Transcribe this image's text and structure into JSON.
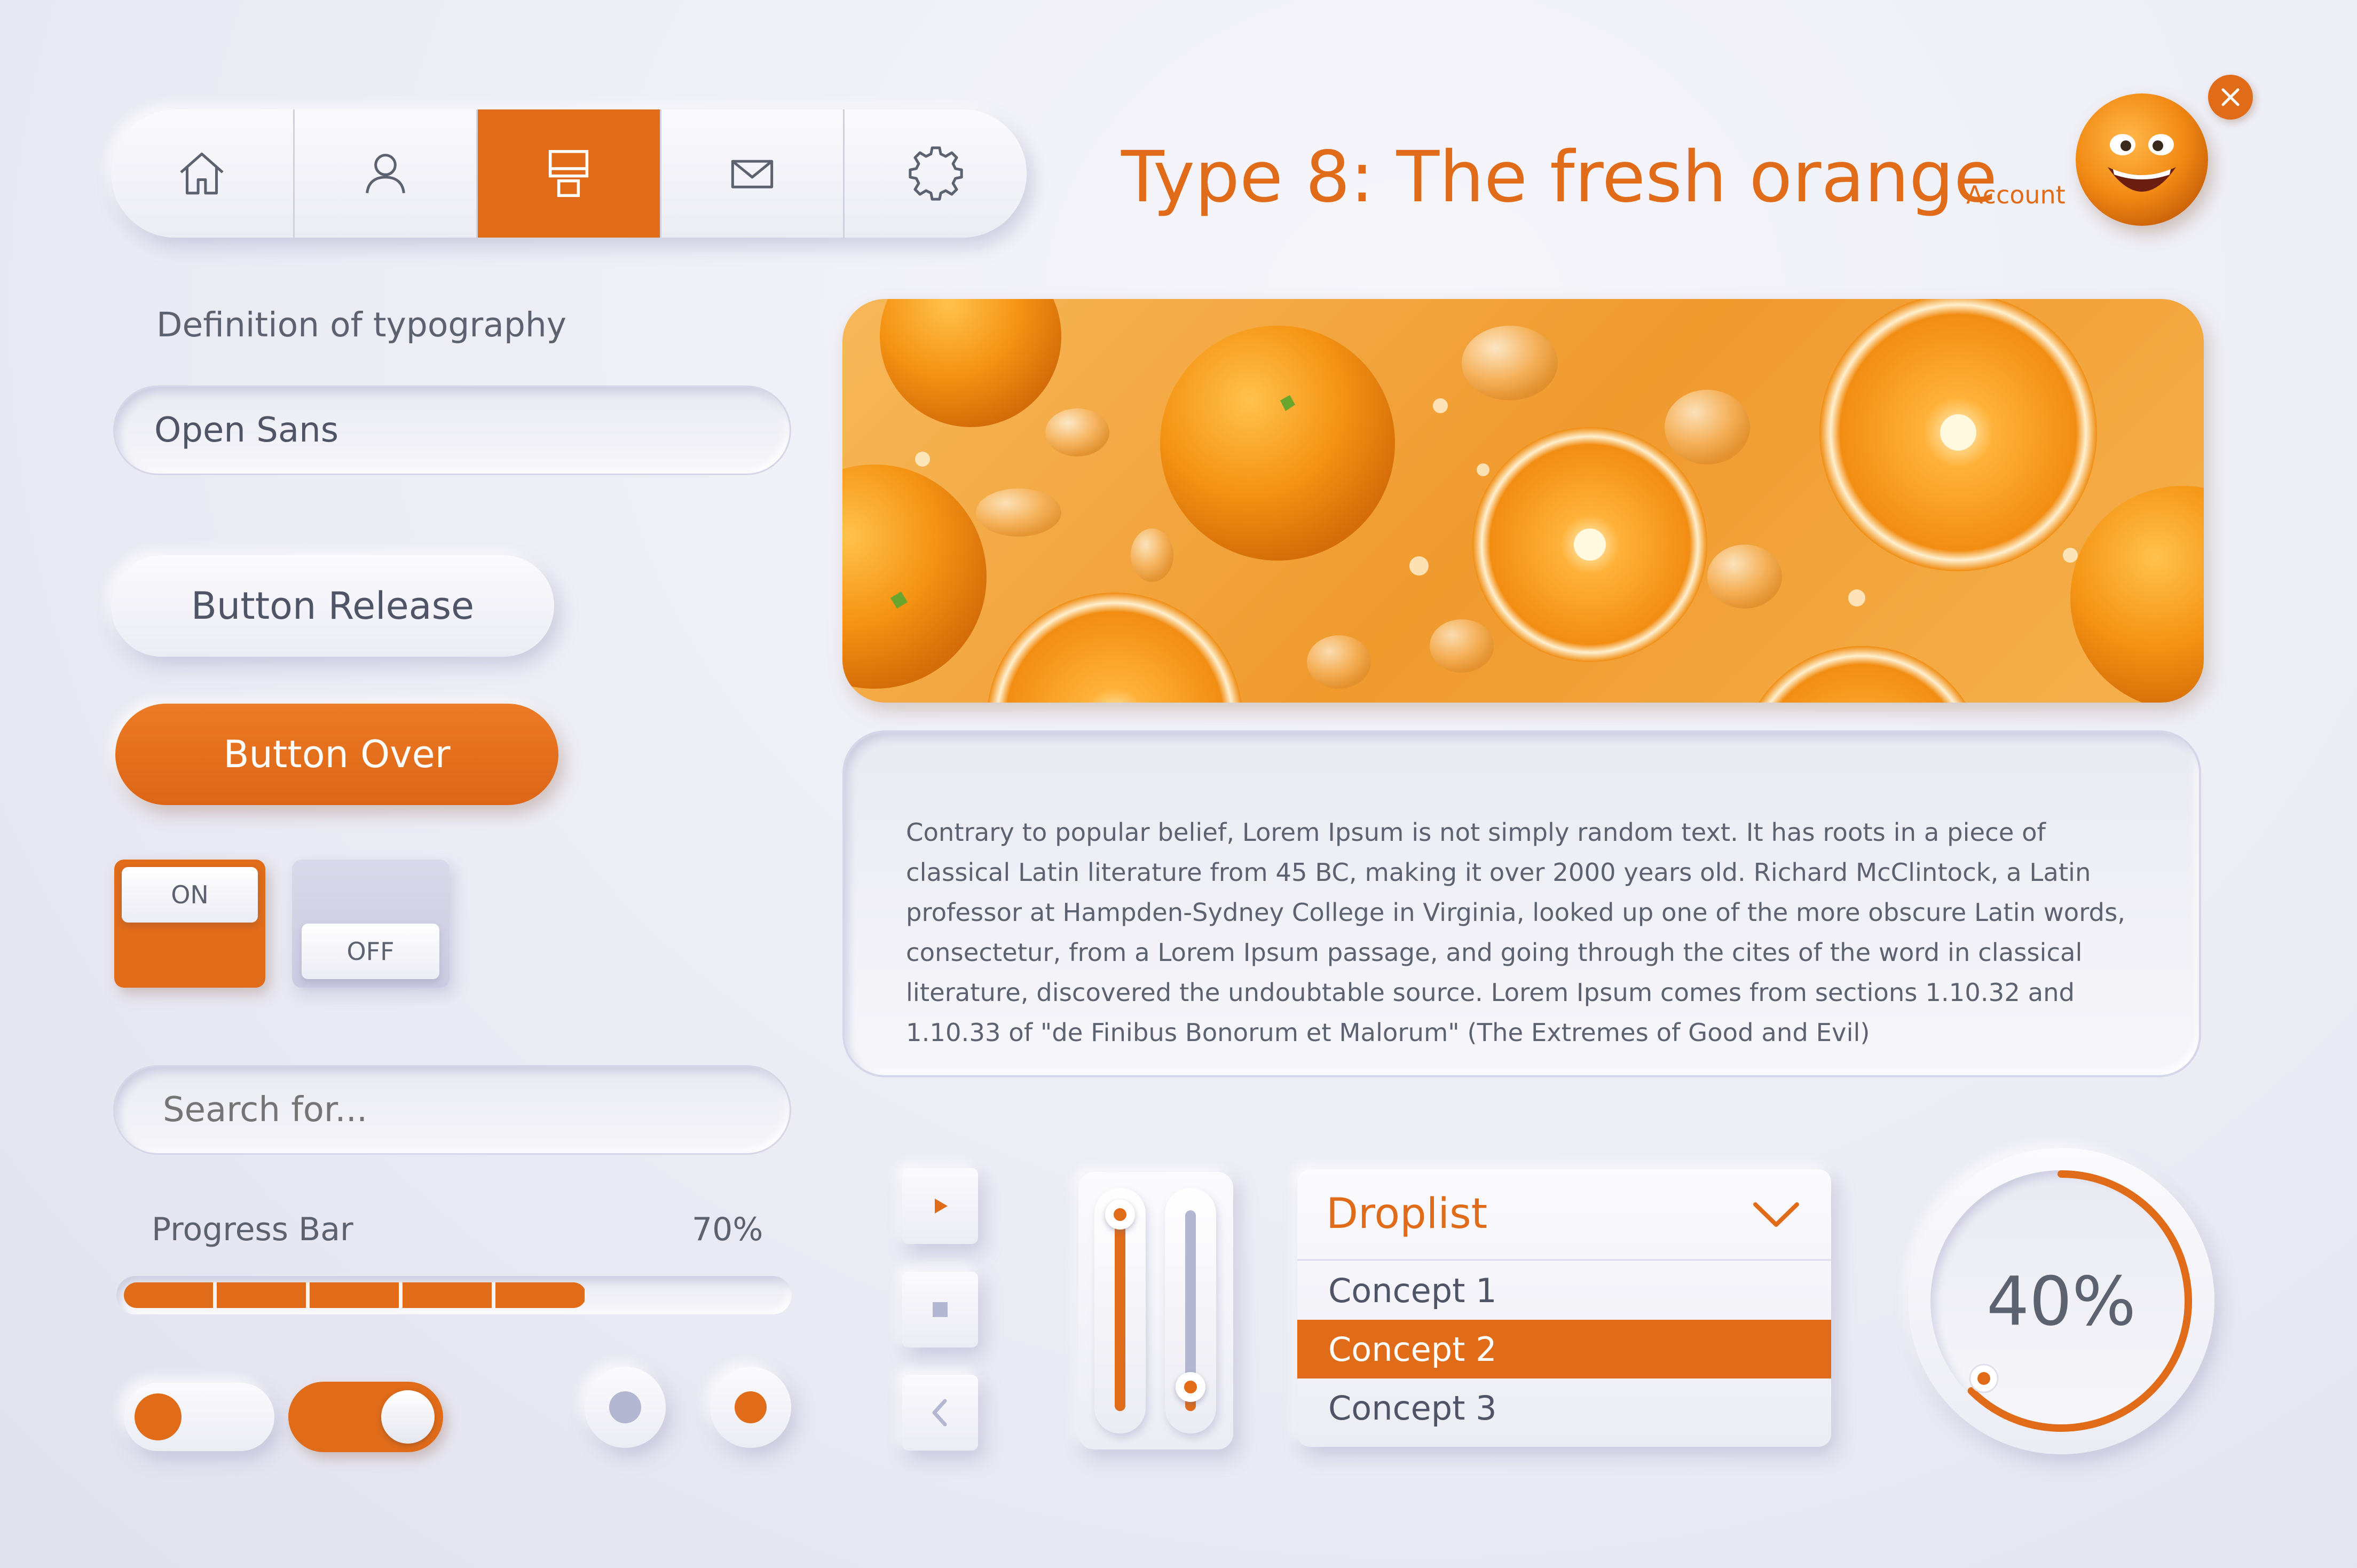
{
  "nav": {
    "items": [
      {
        "icon": "home-icon",
        "active": false
      },
      {
        "icon": "user-icon",
        "active": false
      },
      {
        "icon": "display-icon",
        "active": true
      },
      {
        "icon": "mail-icon",
        "active": false
      },
      {
        "icon": "gear-icon",
        "active": false
      }
    ]
  },
  "header": {
    "title": "Type 8: The fresh orange",
    "account_label": "Account"
  },
  "typography": {
    "label": "Definition of typography",
    "font_value": "Open Sans"
  },
  "buttons": {
    "release_label": "Button Release",
    "over_label": "Button Over"
  },
  "switches": {
    "on_label": "ON",
    "off_label": "OFF"
  },
  "search": {
    "placeholder": "Search for..."
  },
  "progress": {
    "label": "Progress Bar",
    "value_text": "70%",
    "value": 0.7
  },
  "toggles": [
    {
      "state": "off"
    },
    {
      "state": "on"
    }
  ],
  "radios": [
    {
      "selected": false
    },
    {
      "selected": true
    }
  ],
  "article": {
    "text": "Contrary to popular belief, Lorem Ipsum is not simply random text. It has roots in a piece of classical Latin literature from 45 BC, making it over 2000 years old. Richard McClintock, a Latin professor at Hampden-Sydney College in Virginia, looked up one of the more obscure Latin words, consectetur, from a Lorem Ipsum passage, and going through the cites of the word in classical literature, discovered the undoubtable source. Lorem Ipsum comes from sections 1.10.32 and 1.10.33 of \"de Finibus Bonorum et Malorum\" (The Extremes of Good and Evil)"
  },
  "media_controls": [
    {
      "icon": "play-icon"
    },
    {
      "icon": "stop-icon"
    },
    {
      "icon": "chevron-left-icon"
    }
  ],
  "sliders": [
    {
      "level": 0.98
    },
    {
      "level": 0.12
    }
  ],
  "droplist": {
    "title": "Droplist",
    "options": [
      "Concept 1",
      "Concept 2",
      "Concept 3"
    ],
    "selected_index": 1
  },
  "dial": {
    "value_text": "40%",
    "value": 0.4
  },
  "colors": {
    "accent": "#e06c1a",
    "background": "#ececf5",
    "text": "#5d6270",
    "track": "#b4b7d2"
  }
}
